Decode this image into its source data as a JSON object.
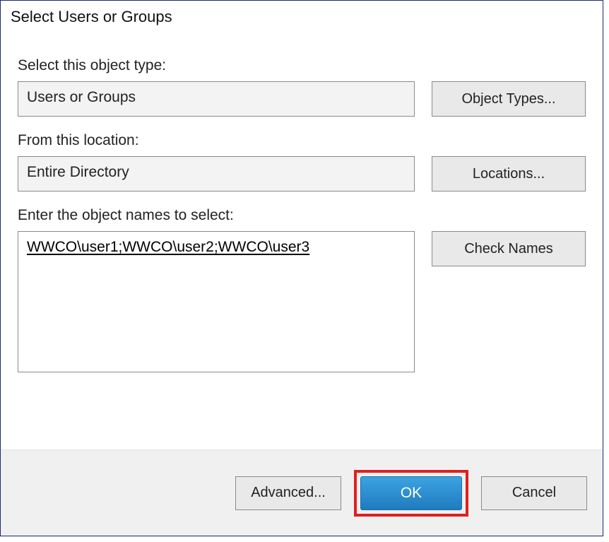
{
  "dialog": {
    "title": "Select Users or Groups"
  },
  "objectType": {
    "label": "Select this object type:",
    "value": "Users or Groups",
    "button": "Object Types..."
  },
  "location": {
    "label": "From this location:",
    "value": "Entire Directory",
    "button": "Locations..."
  },
  "objectNames": {
    "label": "Enter the object names to select:",
    "value": "WWCO\\user1;WWCO\\user2;WWCO\\user3",
    "button": "Check Names"
  },
  "footer": {
    "advanced": "Advanced...",
    "ok": "OK",
    "cancel": "Cancel"
  }
}
